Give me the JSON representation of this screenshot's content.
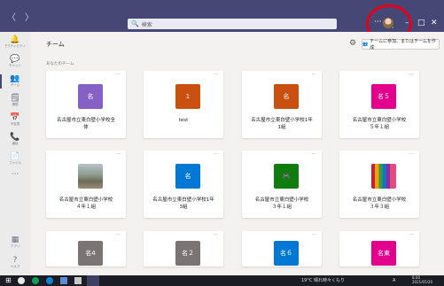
{
  "search": {
    "placeholder": "検索"
  },
  "titlebar": {
    "more": "···",
    "minimize": "–",
    "maximize": "□",
    "close": "✕"
  },
  "rail": [
    {
      "icon": "bell-icon",
      "glyph": "🔔",
      "label": "アクティビティ"
    },
    {
      "icon": "chat-icon",
      "glyph": "💬",
      "label": "チャット"
    },
    {
      "icon": "teams-icon",
      "glyph": "👥",
      "label": "チーム",
      "active": true
    },
    {
      "icon": "assignments-icon",
      "glyph": "🗒",
      "label": "課題"
    },
    {
      "icon": "calendar-icon",
      "glyph": "📅",
      "label": "予定表"
    },
    {
      "icon": "calls-icon",
      "glyph": "📞",
      "label": "通話"
    },
    {
      "icon": "files-icon",
      "glyph": "📄",
      "label": "ファイル"
    },
    {
      "icon": "more-icon",
      "glyph": "···",
      "label": ""
    }
  ],
  "rail_bottom": [
    {
      "icon": "apps-icon",
      "glyph": "▦",
      "label": "アプリ"
    },
    {
      "icon": "help-icon",
      "glyph": "?",
      "label": "ヘルプ"
    }
  ],
  "main": {
    "title": "チーム",
    "join_button": "チームに参加、またはチームを作成",
    "section": "あなたのチーム"
  },
  "teams": [
    {
      "tile": "名",
      "color": "#8661c5",
      "name": "名古屋市立東白壁小学校全\n体"
    },
    {
      "tile": "1",
      "color": "#ca5010",
      "name": "test"
    },
    {
      "tile": "名",
      "color": "#ca5010",
      "name": "名古屋市立東白壁小学校1年\n1組"
    },
    {
      "tile": "名５",
      "color": "#e3008c",
      "name": "名古屋市立東白壁小学校\n５年１組"
    },
    {
      "tile": "",
      "color": "#8c8c7a",
      "name": "名古屋市立東白壁小学校\n４年１組",
      "image": "photo"
    },
    {
      "tile": "名",
      "color": "#0078d4",
      "name": "名古屋市立東白壁小学校1年\n3組"
    },
    {
      "tile": "🎮",
      "color": "#107c10",
      "name": "名古屋市立東白壁小学校\n３年１組"
    },
    {
      "tile": "",
      "color": "#e3008c",
      "name": "名古屋市立東白壁小学校\n３年３組",
      "image": "pencils"
    },
    {
      "tile": "名4",
      "color": "#7a7574",
      "name": ""
    },
    {
      "tile": "名２",
      "color": "#7a7574",
      "name": ""
    },
    {
      "tile": "名６",
      "color": "#0078d4",
      "name": ""
    },
    {
      "tile": "名東",
      "color": "#e3008c",
      "name": ""
    }
  ],
  "taskbar": {
    "weather": "19°C 晴れ時々くもり",
    "ime": "A",
    "time": "8:40",
    "date": "2021/05/20"
  }
}
